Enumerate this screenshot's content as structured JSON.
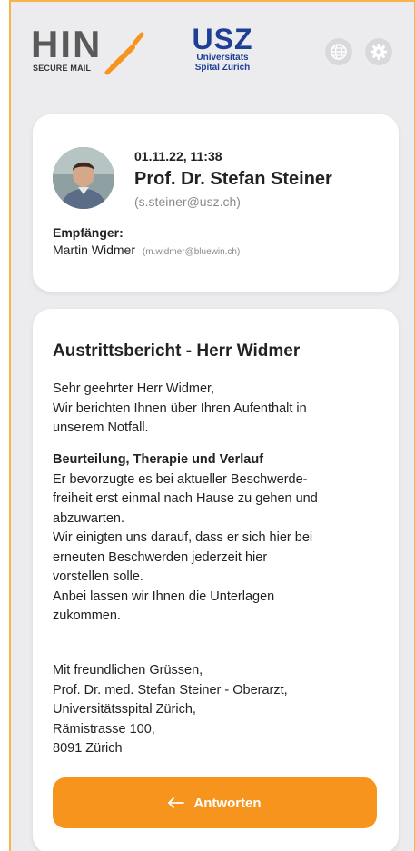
{
  "header": {
    "hin_logo_text": "HIN",
    "hin_logo_sub": "SECURE MAIL",
    "usz_logo_text": "USZ",
    "usz_logo_sub_line1": "Universitäts",
    "usz_logo_sub_line2": "Spital Zürich",
    "globe_icon": "globe-icon",
    "settings_icon": "gear-icon"
  },
  "sender_card": {
    "timestamp": "01.11.22, 11:38",
    "sender_name": "Prof. Dr. Stefan Steiner",
    "sender_email": "(s.steiner@usz.ch)",
    "recipient_label": "Empfänger:",
    "recipient_name": "Martin Widmer",
    "recipient_email": "(m.widmer@bluewin.ch)"
  },
  "message": {
    "subject": "Austrittsbericht - Herr Widmer",
    "intro_lines": [
      "Sehr geehrter Herr Widmer,",
      "Wir berichten Ihnen über Ihren Aufenthalt in",
      "unserem Notfall."
    ],
    "section_title": "Beurteilung, Therapie und Verlauf",
    "section_lines": [
      "Er bevorzugte es bei aktueller Beschwerde-",
      "freiheit erst einmal nach Hause zu gehen und",
      "abzuwarten.",
      "Wir einigten uns darauf, dass er sich hier bei",
      "erneuten Beschwerden jederzeit hier",
      "vorstellen solle.",
      "Anbei lassen wir Ihnen die Unterlagen",
      "zukommen."
    ],
    "closing_lines": [
      "Mit freundlichen Grüssen,",
      "Prof. Dr. med. Stefan Steiner - Oberarzt,",
      "Universitätsspital Zürich,",
      "Rämistrasse 100,",
      "8091 Zürich"
    ],
    "reply_label": "Antworten",
    "reply_icon": "reply-arrow-icon"
  },
  "colors": {
    "accent": "#f7941d",
    "usz_blue": "#1e3f94",
    "background": "#ececee"
  }
}
